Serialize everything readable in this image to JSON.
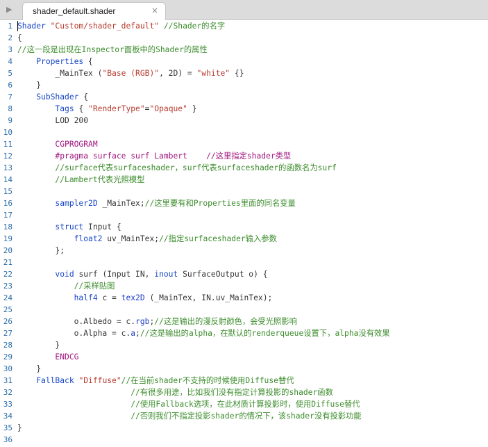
{
  "tab": {
    "label": "shader_default.shader",
    "close_glyph": "×",
    "play_glyph": "▶"
  },
  "colors": {
    "keyword": "#1747c7",
    "string": "#b83b2e",
    "comment": "#3c8c2c",
    "preprocessor": "#a1167e",
    "plain": "#333333",
    "line_number": "#2b6ca8"
  },
  "lines": [
    {
      "n": "1",
      "tokens": [
        {
          "t": "Shader",
          "c": "kw"
        },
        {
          "t": " ",
          "c": "plain"
        },
        {
          "t": "\"Custom/shader_default\"",
          "c": "str"
        },
        {
          "t": " //Shader的名字",
          "c": "cm"
        }
      ]
    },
    {
      "n": "2",
      "tokens": [
        {
          "t": "{",
          "c": "plain"
        }
      ]
    },
    {
      "n": "3",
      "tokens": [
        {
          "t": "//这一段是出现在Inspector面板中的Shader的属性",
          "c": "cm"
        }
      ]
    },
    {
      "n": "4",
      "tokens": [
        {
          "t": "    ",
          "c": "plain"
        },
        {
          "t": "Properties",
          "c": "kw"
        },
        {
          "t": " {",
          "c": "plain"
        }
      ]
    },
    {
      "n": "5",
      "tokens": [
        {
          "t": "        _MainTex (",
          "c": "plain"
        },
        {
          "t": "\"Base (RGB)\"",
          "c": "str"
        },
        {
          "t": ", 2D) = ",
          "c": "plain"
        },
        {
          "t": "\"white\"",
          "c": "str"
        },
        {
          "t": " {}",
          "c": "plain"
        }
      ]
    },
    {
      "n": "6",
      "tokens": [
        {
          "t": "    }",
          "c": "plain"
        }
      ]
    },
    {
      "n": "7",
      "tokens": [
        {
          "t": "    ",
          "c": "plain"
        },
        {
          "t": "SubShader",
          "c": "kw"
        },
        {
          "t": " {",
          "c": "plain"
        }
      ]
    },
    {
      "n": "8",
      "tokens": [
        {
          "t": "        ",
          "c": "plain"
        },
        {
          "t": "Tags",
          "c": "kw"
        },
        {
          "t": " { ",
          "c": "plain"
        },
        {
          "t": "\"RenderType\"",
          "c": "str"
        },
        {
          "t": "=",
          "c": "plain"
        },
        {
          "t": "\"Opaque\"",
          "c": "str"
        },
        {
          "t": " }",
          "c": "plain"
        }
      ]
    },
    {
      "n": "9",
      "tokens": [
        {
          "t": "        LOD 200",
          "c": "plain"
        }
      ]
    },
    {
      "n": "10",
      "tokens": []
    },
    {
      "n": "11",
      "tokens": [
        {
          "t": "        ",
          "c": "plain"
        },
        {
          "t": "CGPROGRAM",
          "c": "pp"
        }
      ]
    },
    {
      "n": "12",
      "tokens": [
        {
          "t": "        ",
          "c": "plain"
        },
        {
          "t": "#pragma surface surf Lambert",
          "c": "pp"
        },
        {
          "t": "    //这里指定shader类型",
          "c": "pp"
        }
      ]
    },
    {
      "n": "13",
      "tokens": [
        {
          "t": "        //surface代表surfaceshader，surf代表surfaceshader的函数名为surf",
          "c": "cm"
        }
      ]
    },
    {
      "n": "14",
      "tokens": [
        {
          "t": "        //Lambert代表光照模型",
          "c": "cm"
        }
      ]
    },
    {
      "n": "15",
      "tokens": []
    },
    {
      "n": "16",
      "tokens": [
        {
          "t": "        ",
          "c": "plain"
        },
        {
          "t": "sampler2D",
          "c": "ty"
        },
        {
          "t": " _MainTex;",
          "c": "plain"
        },
        {
          "t": "//这里要有和Properties里面的同名变量",
          "c": "cm"
        }
      ]
    },
    {
      "n": "17",
      "tokens": []
    },
    {
      "n": "18",
      "tokens": [
        {
          "t": "        ",
          "c": "plain"
        },
        {
          "t": "struct",
          "c": "kw"
        },
        {
          "t": " Input {",
          "c": "plain"
        }
      ]
    },
    {
      "n": "19",
      "tokens": [
        {
          "t": "            ",
          "c": "plain"
        },
        {
          "t": "float2",
          "c": "ty"
        },
        {
          "t": " uv_MainTex;",
          "c": "plain"
        },
        {
          "t": "//指定surfaceshader输入参数",
          "c": "cm"
        }
      ]
    },
    {
      "n": "20",
      "tokens": [
        {
          "t": "        };",
          "c": "plain"
        }
      ]
    },
    {
      "n": "21",
      "tokens": []
    },
    {
      "n": "22",
      "tokens": [
        {
          "t": "        ",
          "c": "plain"
        },
        {
          "t": "void",
          "c": "kw"
        },
        {
          "t": " surf (Input IN, ",
          "c": "plain"
        },
        {
          "t": "inout",
          "c": "kw"
        },
        {
          "t": " SurfaceOutput o) {",
          "c": "plain"
        }
      ]
    },
    {
      "n": "23",
      "tokens": [
        {
          "t": "            //采样贴图",
          "c": "cm"
        }
      ]
    },
    {
      "n": "24",
      "tokens": [
        {
          "t": "            ",
          "c": "plain"
        },
        {
          "t": "half4",
          "c": "ty"
        },
        {
          "t": " c = ",
          "c": "plain"
        },
        {
          "t": "tex2D",
          "c": "fn"
        },
        {
          "t": " (_MainTex, IN.uv_MainTex);",
          "c": "plain"
        }
      ]
    },
    {
      "n": "25",
      "tokens": []
    },
    {
      "n": "26",
      "tokens": [
        {
          "t": "            o.Albedo = c.",
          "c": "plain"
        },
        {
          "t": "rgb",
          "c": "fn"
        },
        {
          "t": ";",
          "c": "plain"
        },
        {
          "t": "//这是输出的漫反射颜色，会受光照影响",
          "c": "cm"
        }
      ]
    },
    {
      "n": "27",
      "tokens": [
        {
          "t": "            o.Alpha = c.",
          "c": "plain"
        },
        {
          "t": "a",
          "c": "fn"
        },
        {
          "t": ";",
          "c": "plain"
        },
        {
          "t": "//这是输出的alpha，在默认的renderqueue设置下，alpha没有效果",
          "c": "cm"
        }
      ]
    },
    {
      "n": "28",
      "tokens": [
        {
          "t": "        }",
          "c": "plain"
        }
      ]
    },
    {
      "n": "29",
      "tokens": [
        {
          "t": "        ",
          "c": "plain"
        },
        {
          "t": "ENDCG",
          "c": "pp"
        }
      ]
    },
    {
      "n": "30",
      "tokens": [
        {
          "t": "    }",
          "c": "plain"
        }
      ]
    },
    {
      "n": "31",
      "tokens": [
        {
          "t": "    ",
          "c": "plain"
        },
        {
          "t": "FallBack",
          "c": "kw"
        },
        {
          "t": " ",
          "c": "plain"
        },
        {
          "t": "\"Diffuse\"",
          "c": "str"
        },
        {
          "t": "//在当前shader不支持的时候使用Diffuse替代",
          "c": "cm"
        }
      ]
    },
    {
      "n": "32",
      "tokens": [
        {
          "t": "                        //有很多用途，比如我们没有指定计算投影的shader函数",
          "c": "cm"
        }
      ]
    },
    {
      "n": "33",
      "tokens": [
        {
          "t": "                        //使用Fallback选项，在此材质计算投影时，使用Diffuse替代",
          "c": "cm"
        }
      ]
    },
    {
      "n": "34",
      "tokens": [
        {
          "t": "                        //否则我们不指定投影shader的情况下，该shader没有投影功能",
          "c": "cm"
        }
      ]
    },
    {
      "n": "35",
      "tokens": [
        {
          "t": "}",
          "c": "plain"
        }
      ]
    },
    {
      "n": "36",
      "tokens": []
    }
  ]
}
